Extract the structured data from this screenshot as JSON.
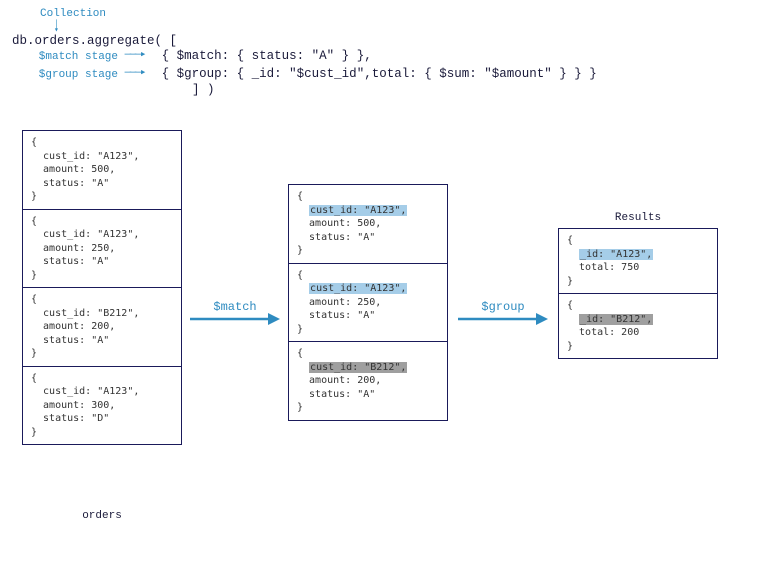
{
  "header": {
    "collection_label": "Collection",
    "code_prefix": "db.orders.aggregate( [",
    "match_label": "$match stage",
    "group_label": "$group stage",
    "match_code": "{ $match: { status: \"A\" } },",
    "group_code": "{ $group: { _id: \"$cust_id\",total: { $sum: \"$amount\" } } }",
    "code_suffix": "] )"
  },
  "orders_label": "orders",
  "results_label": "Results",
  "op_match": "$match",
  "op_group": "$group",
  "orders": [
    {
      "open": "{",
      "l1": "  cust_id: \"A123\",",
      "l2": "  amount: 500,",
      "l3": "  status: \"A\"",
      "close": "}"
    },
    {
      "open": "{",
      "l1": "  cust_id: \"A123\",",
      "l2": "  amount: 250,",
      "l3": "  status: \"A\"",
      "close": "}"
    },
    {
      "open": "{",
      "l1": "  cust_id: \"B212\",",
      "l2": "  amount: 200,",
      "l3": "  status: \"A\"",
      "close": "}"
    },
    {
      "open": "{",
      "l1": "  cust_id: \"A123\",",
      "l2": "  amount: 300,",
      "l3": "  status: \"D\"",
      "close": "}"
    }
  ],
  "matched": [
    {
      "open": "{",
      "hl": "cust_id: \"A123\",",
      "hlclass": "hl-blue",
      "l2": "  amount: 500,",
      "l3": "  status: \"A\"",
      "close": "}"
    },
    {
      "open": "{",
      "hl": "cust_id: \"A123\",",
      "hlclass": "hl-blue",
      "l2": "  amount: 250,",
      "l3": "  status: \"A\"",
      "close": "}"
    },
    {
      "open": "{",
      "hl": "cust_id: \"B212\",",
      "hlclass": "hl-grey",
      "l2": "  amount: 200,",
      "l3": "  status: \"A\"",
      "close": "}"
    }
  ],
  "results": [
    {
      "open": "{",
      "hl": "_id: \"A123\",",
      "hlclass": "hl-blue",
      "l2": "  total: 750",
      "close": "}"
    },
    {
      "open": "{",
      "hl": "_id: \"B212\",",
      "hlclass": "hl-grey",
      "l2": "  total: 200",
      "close": "}"
    }
  ]
}
